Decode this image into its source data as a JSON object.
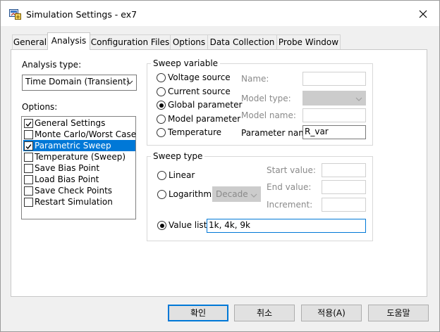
{
  "window": {
    "title": "Simulation Settings - ex7",
    "close_icon": "close-icon",
    "app_icon": "simulation-app-icon"
  },
  "tabs": [
    {
      "label": "General",
      "active": false
    },
    {
      "label": "Analysis",
      "active": true
    },
    {
      "label": "Configuration Files",
      "active": false
    },
    {
      "label": "Options",
      "active": false
    },
    {
      "label": "Data Collection",
      "active": false
    },
    {
      "label": "Probe Window",
      "active": false
    }
  ],
  "analysis_type": {
    "label": "Analysis type:",
    "value": "Time Domain (Transient)"
  },
  "options": {
    "label": "Options:",
    "items": [
      {
        "label": "General Settings",
        "checked": true,
        "selected": false
      },
      {
        "label": "Monte Carlo/Worst Case",
        "checked": false,
        "selected": false
      },
      {
        "label": "Parametric Sweep",
        "checked": true,
        "selected": true
      },
      {
        "label": "Temperature (Sweep)",
        "checked": false,
        "selected": false
      },
      {
        "label": "Save Bias Point",
        "checked": false,
        "selected": false
      },
      {
        "label": "Load Bias Point",
        "checked": false,
        "selected": false
      },
      {
        "label": "Save Check Points",
        "checked": false,
        "selected": false
      },
      {
        "label": "Restart Simulation",
        "checked": false,
        "selected": false
      }
    ]
  },
  "sweep_variable": {
    "title": "Sweep variable",
    "radios": [
      {
        "label": "Voltage source",
        "checked": false
      },
      {
        "label": "Current source",
        "checked": false
      },
      {
        "label": "Global parameter",
        "checked": true
      },
      {
        "label": "Model parameter",
        "checked": false
      },
      {
        "label": "Temperature",
        "checked": false
      }
    ],
    "name_label": "Name:",
    "name_value": "",
    "model_type_label": "Model type:",
    "model_type_value": "",
    "model_name_label": "Model name:",
    "model_name_value": "",
    "parameter_name_label": "Parameter name:",
    "parameter_name_value": "R_var"
  },
  "sweep_type": {
    "title": "Sweep type",
    "linear_label": "Linear",
    "linear_checked": false,
    "log_label": "Logarithmic",
    "log_checked": false,
    "log_combo_value": "Decade",
    "start_label": "Start value:",
    "start_value": "",
    "end_label": "End value:",
    "end_value": "",
    "increment_label": "Increment:",
    "increment_value": "",
    "value_list_label": "Value list",
    "value_list_checked": true,
    "value_list_value": "1k, 4k, 9k"
  },
  "buttons": {
    "ok": "확인",
    "cancel": "취소",
    "apply": "적용(A)",
    "help": "도움말"
  },
  "colors": {
    "accent": "#0078d7",
    "selection": "#0078d7",
    "disabled_text": "#8a8a8a"
  }
}
